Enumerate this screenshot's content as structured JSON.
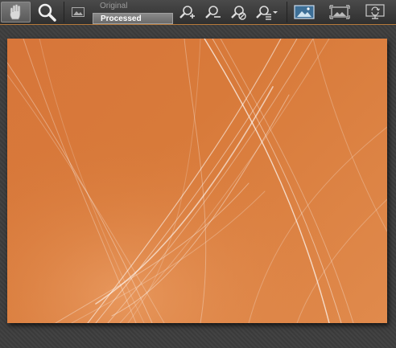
{
  "toolbar": {
    "tools": [
      {
        "name": "hand-tool",
        "icon": "hand-icon"
      },
      {
        "name": "zoom-tool",
        "icon": "magnifier-icon"
      }
    ],
    "view_toggle": {
      "options": [
        "Original",
        "Processed"
      ],
      "selected": "Processed"
    },
    "zoom_buttons": [
      "zoom-in-icon",
      "zoom-out-icon",
      "zoom-reset-icon",
      "zoom-menu-icon"
    ],
    "view_buttons": [
      "fit-image-icon",
      "fit-width-icon",
      "fit-screen-icon"
    ]
  },
  "colors": {
    "image_background": "#d87a3a",
    "streak": "#ffffff",
    "toolbar_accent": "#b77a3b"
  }
}
